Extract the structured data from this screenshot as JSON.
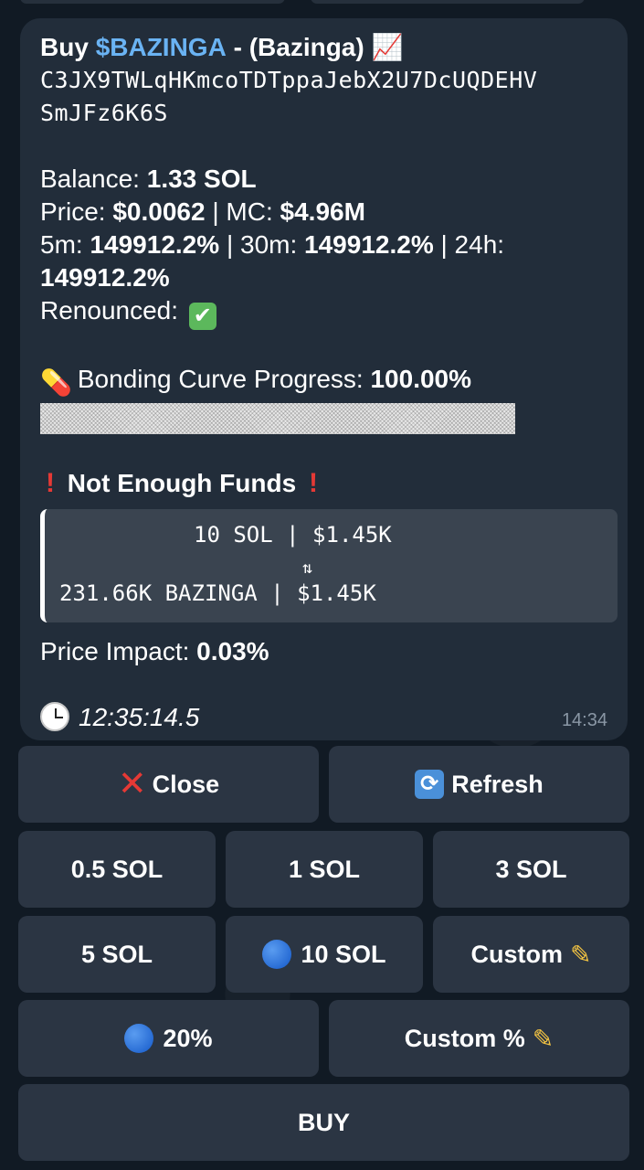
{
  "message": {
    "buy_prefix": "Buy",
    "ticker": "$BAZINGA",
    "name_suffix": "- (Bazinga)",
    "chart_emoji": "📈",
    "address_line1": "C3JX9TWLqHKmcoTDTppaJebX2U7DcUQDEHV",
    "address_line2": "SmJFz6K6S",
    "balance_label": "Balance:",
    "balance_value": "1.33 SOL",
    "price_label": "Price:",
    "price_value": "$0.0062",
    "mc_sep": "| MC:",
    "mc_value": "$4.96M",
    "m5_label": "5m:",
    "m5_value": "149912.2%",
    "m30_label": "| 30m:",
    "m30_value": "149912.2%",
    "h24_label": "| 24h:",
    "h24_value": "149912.2%",
    "renounced_label": "Renounced:",
    "renounced_check": "✔",
    "pill_emoji": "💊",
    "bonding_label": "Bonding Curve Progress:",
    "bonding_value": "100.00%",
    "bonding_fraction": 1.0,
    "warn_mark": "!",
    "warning_text": "Not Enough Funds",
    "quote_from": "10 SOL | $1.45K",
    "quote_arrow": "⇅",
    "quote_to": "231.66K BAZINGA | $1.45K",
    "impact_label": "Price Impact:",
    "impact_value": "0.03%",
    "clock_time": "12:35:14.5",
    "timestamp": "14:34"
  },
  "buttons": {
    "close": "Close",
    "refresh": "Refresh",
    "sol_05": "0.5 SOL",
    "sol_1": "1 SOL",
    "sol_3": "3 SOL",
    "sol_5": "5 SOL",
    "sol_10": "10 SOL",
    "custom": "Custom",
    "pct_20": "20%",
    "custom_pct": "Custom %",
    "buy": "BUY"
  },
  "colors": {
    "link": "#6ab3f3",
    "bubble": "#222d3a",
    "button": "#2b3543",
    "warning": "#e53935"
  }
}
